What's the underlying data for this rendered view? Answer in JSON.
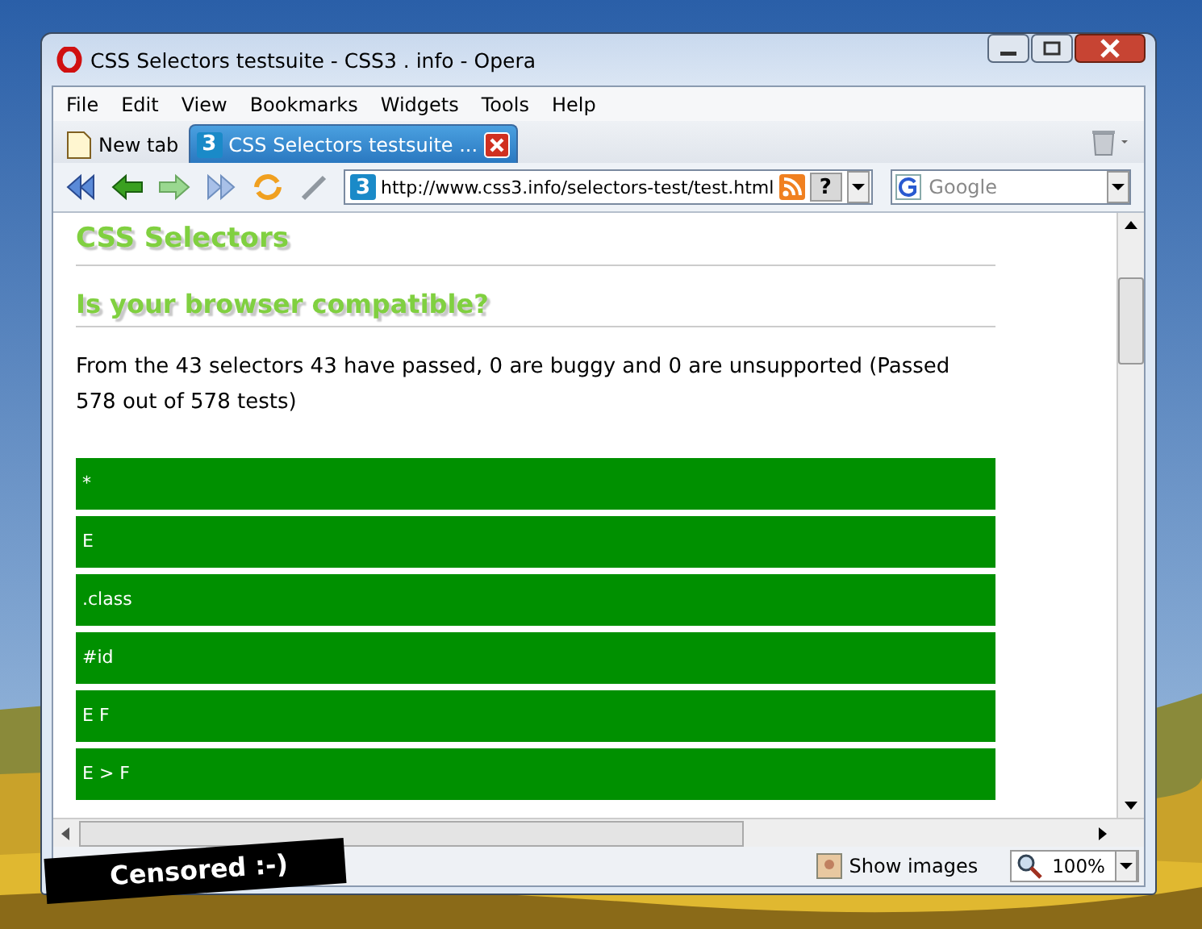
{
  "window": {
    "title": "CSS Selectors testsuite - CSS3 . info - Opera"
  },
  "menu": [
    "File",
    "Edit",
    "View",
    "Bookmarks",
    "Widgets",
    "Tools",
    "Help"
  ],
  "tabs": [
    {
      "label": "New tab",
      "selected": false,
      "kind": "blank"
    },
    {
      "label": "CSS Selectors testsuite ...",
      "selected": true,
      "kind": "site",
      "icon": "3"
    }
  ],
  "address": {
    "site_icon": "3",
    "value": "http://www.css3.info/selectors-test/test.html",
    "help": "?"
  },
  "search": {
    "placeholder": "Google"
  },
  "page": {
    "heading": "CSS Selectors",
    "subheading": "Is your browser compatible?",
    "summary": "From the 43 selectors 43 have passed, 0 are buggy and 0 are unsupported (Passed 578 out of 578 tests)",
    "results": [
      {
        "selector": "*",
        "color": "#009000"
      },
      {
        "selector": "E",
        "color": "#009000"
      },
      {
        "selector": ".class",
        "color": "#009000"
      },
      {
        "selector": "#id",
        "color": "#009000"
      },
      {
        "selector": "E F",
        "color": "#009000"
      },
      {
        "selector": "E > F",
        "color": "#009000"
      }
    ]
  },
  "status_bar": {
    "show_images": "Show images",
    "zoom": "100%"
  },
  "overlay_label": "Censored :-)"
}
